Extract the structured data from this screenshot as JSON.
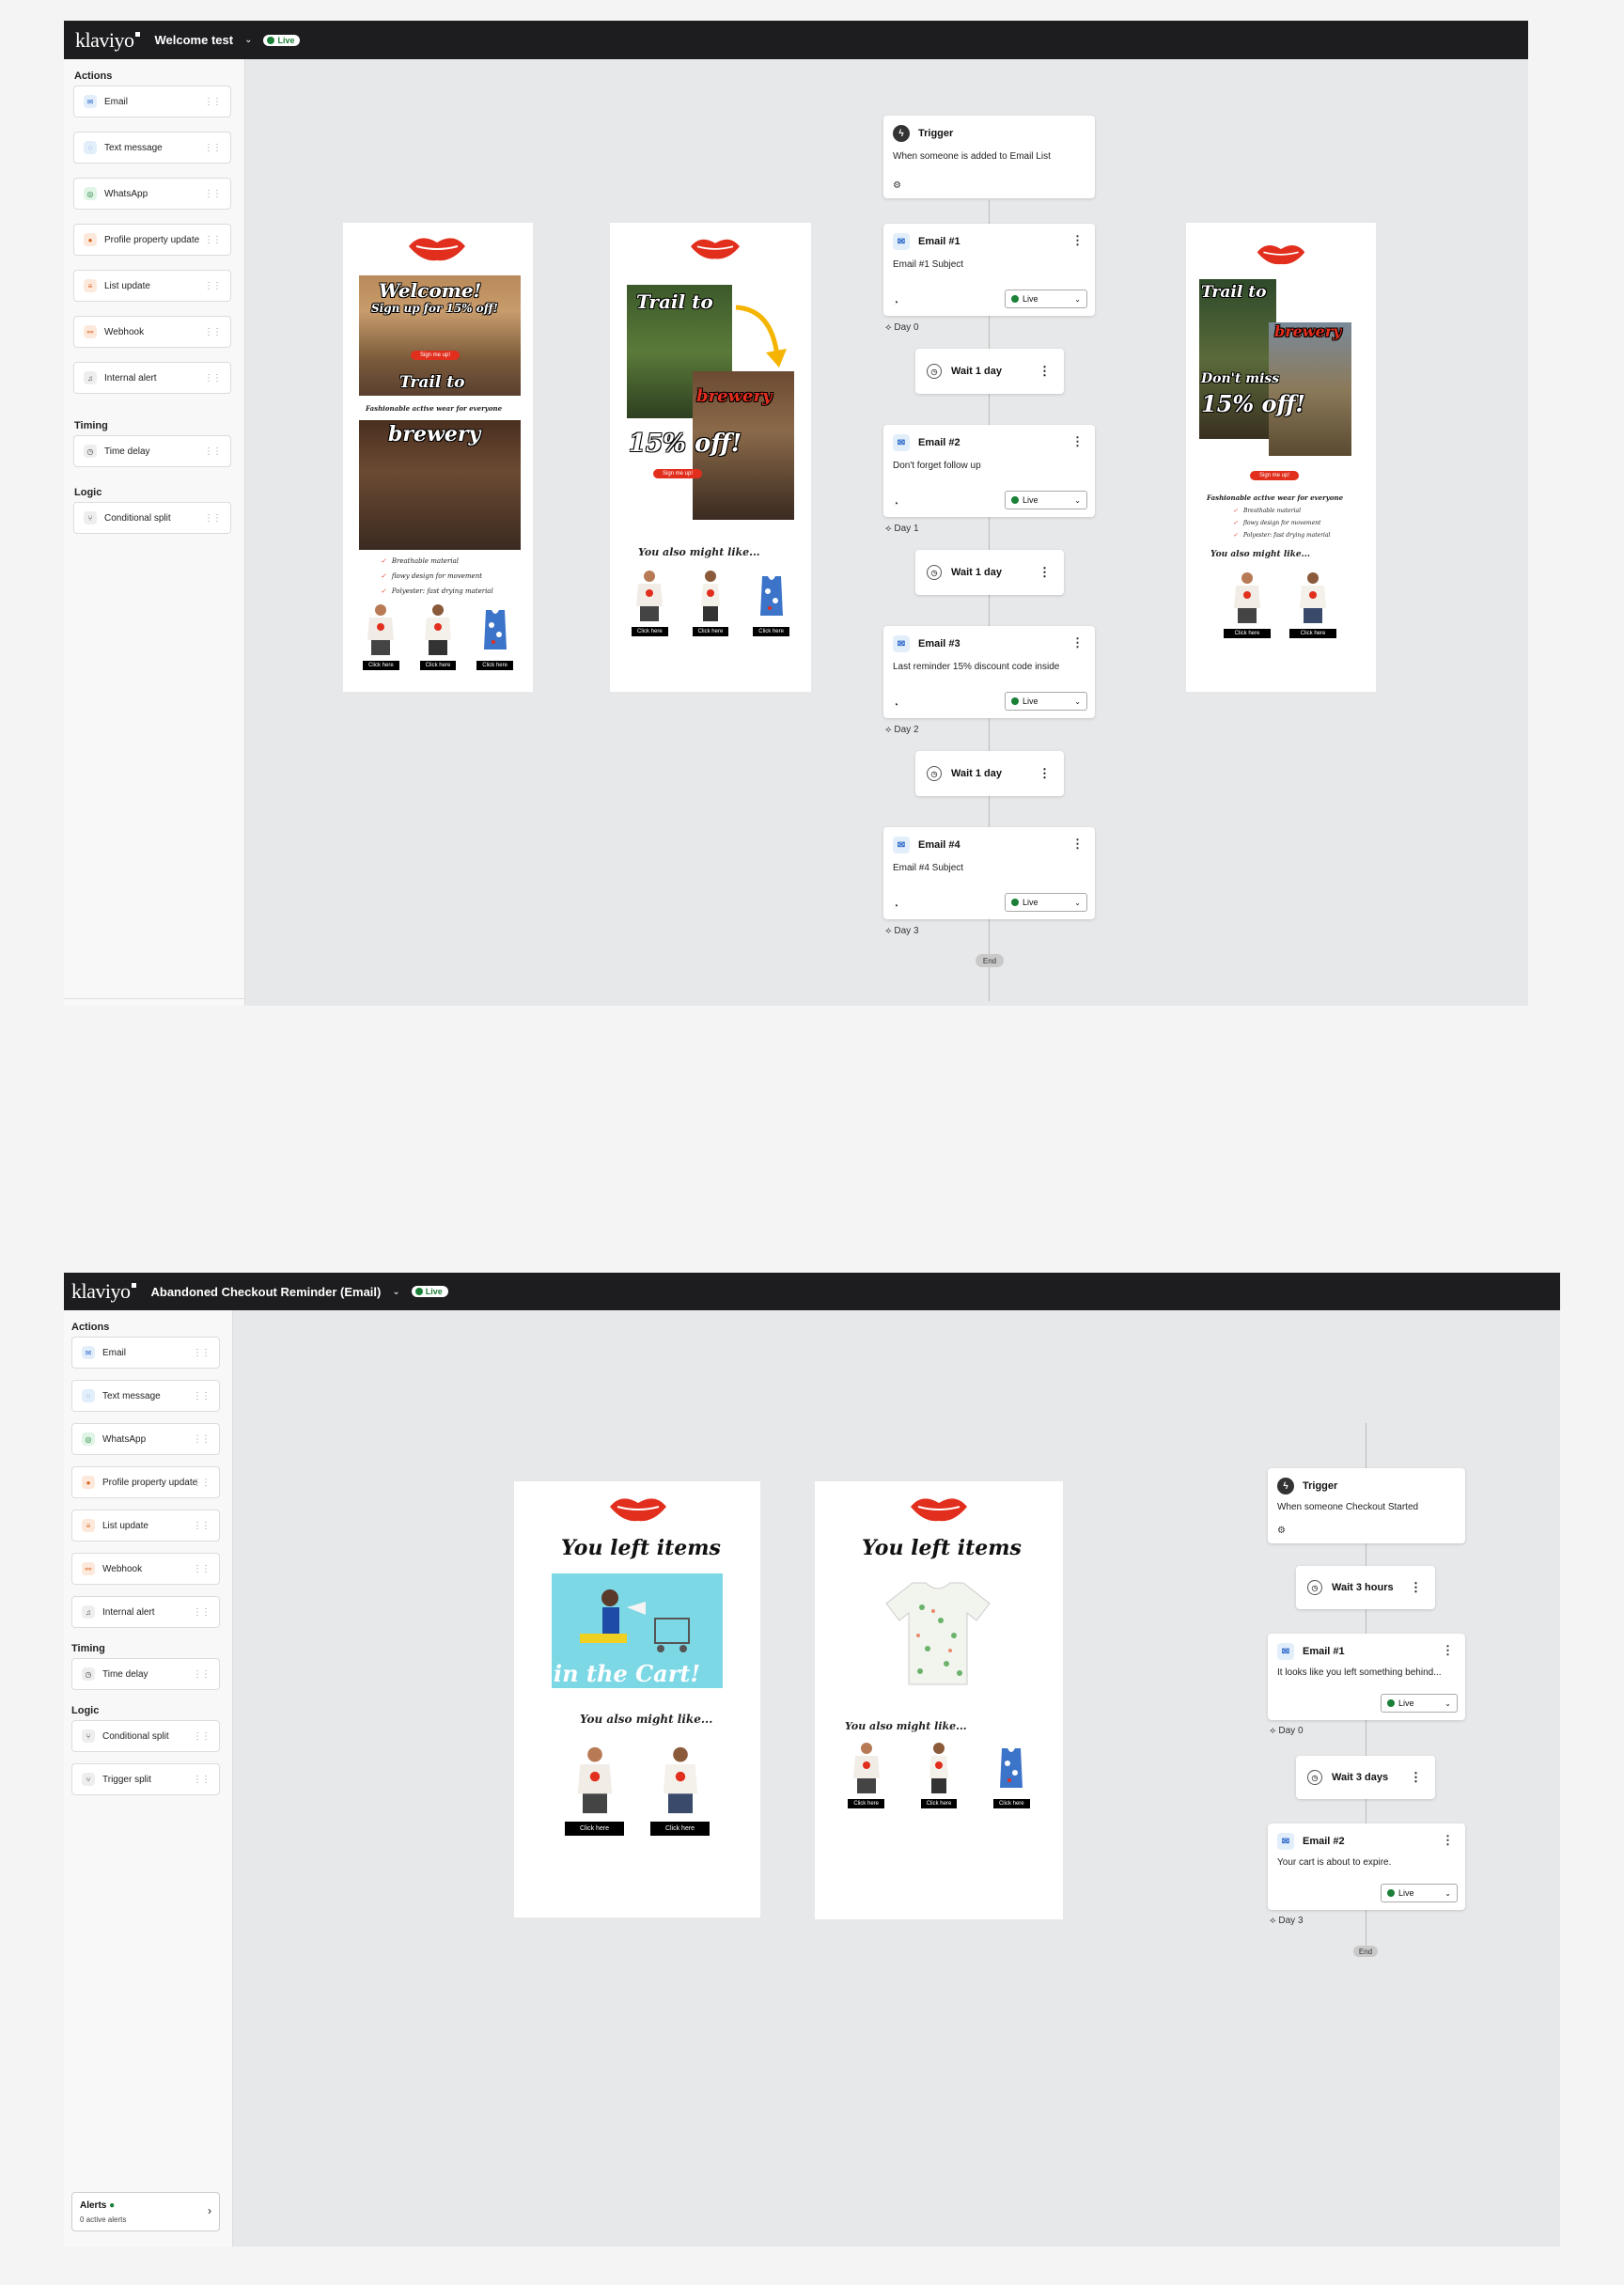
{
  "flow1": {
    "logo": "klaviyo",
    "name": "Welcome test",
    "status": "Live",
    "sidebar": {
      "actions_title": "Actions",
      "actions": [
        "Email",
        "Text message",
        "WhatsApp",
        "Profile property update",
        "List update",
        "Webhook",
        "Internal alert"
      ],
      "timing_title": "Timing",
      "timing": [
        "Time delay"
      ],
      "logic_title": "Logic",
      "logic": [
        "Conditional split"
      ]
    },
    "trigger": {
      "title": "Trigger",
      "desc": "When someone is added to Email List"
    },
    "emails": [
      {
        "title": "Email #1",
        "subject": "Email #1 Subject",
        "status": "Live",
        "day": "Day 0"
      },
      {
        "title": "Email #2",
        "subject": "Don't forget follow up",
        "status": "Live",
        "day": "Day 1"
      },
      {
        "title": "Email #3",
        "subject": "Last reminder 15% discount code inside",
        "status": "Live",
        "day": "Day 2"
      },
      {
        "title": "Email #4",
        "subject": "Email #4 Subject",
        "status": "Live",
        "day": "Day 3"
      }
    ],
    "waits": [
      "Wait 1 day",
      "Wait 1 day",
      "Wait 1 day"
    ],
    "end": "End",
    "preview1": {
      "welcome": "Welcome!",
      "signup": "Sign up for 15% off!",
      "cta": "Sign me up!",
      "trail": "Trail to",
      "tagline": "Fashionable active wear for everyone",
      "brewery": "brewery",
      "checks": [
        "Breathable material",
        "flowy design for movement",
        "Polyester: fast drying material"
      ],
      "btn": "Click here"
    },
    "preview2": {
      "trail": "Trail to",
      "brewery": "brewery",
      "off": "15% off!",
      "cta": "Sign me up!",
      "also": "You also might like...",
      "btn": "Click here"
    },
    "preview3": {
      "trail": "Trail to",
      "brewery": "brewery",
      "dontmiss": "Don't miss",
      "off": "15% off!",
      "cta": "Sign me up!",
      "tagline": "Fashionable active wear for everyone",
      "checks": [
        "Breathable material",
        "flowy design for movement",
        "Polyester: fast drying material"
      ],
      "also": "You also might like...",
      "btn": "Click here"
    }
  },
  "flow2": {
    "logo": "klaviyo",
    "name": "Abandoned Checkout Reminder (Email)",
    "status": "Live",
    "sidebar": {
      "actions_title": "Actions",
      "actions": [
        "Email",
        "Text message",
        "WhatsApp",
        "Profile property update",
        "List update",
        "Webhook",
        "Internal alert"
      ],
      "timing_title": "Timing",
      "timing": [
        "Time delay"
      ],
      "logic_title": "Logic",
      "logic": [
        "Conditional split",
        "Trigger split"
      ]
    },
    "trigger": {
      "title": "Trigger",
      "desc": "When someone Checkout Started"
    },
    "waits": [
      "Wait 3 hours",
      "Wait 3 days"
    ],
    "emails": [
      {
        "title": "Email #1",
        "subject": "It looks like you left something behind...",
        "status": "Live",
        "day": "Day 0"
      },
      {
        "title": "Email #2",
        "subject": "Your cart is about to expire.",
        "status": "Live",
        "day": "Day 3"
      }
    ],
    "end": "End",
    "alerts": {
      "title": "Alerts",
      "sub": "0 active alerts"
    },
    "preview1": {
      "title": "You left items",
      "cart": "in the Cart!",
      "also": "You also might like...",
      "btn": "Click here"
    },
    "preview2": {
      "title": "You left items",
      "also": "You also might like...",
      "btn": "Click here"
    }
  },
  "colors": {
    "accent_red": "#e12e1d",
    "live_green": "#1a7f37",
    "topbar": "#1d1d1f",
    "canvas": "#e7e8ea"
  }
}
